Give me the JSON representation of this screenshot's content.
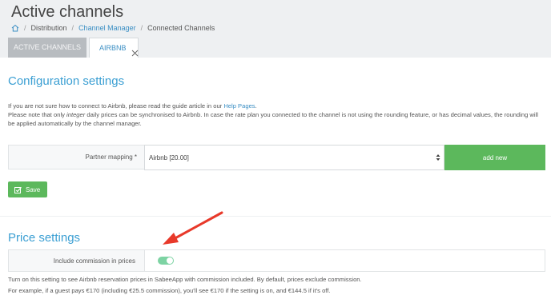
{
  "header": {
    "title": "Active channels",
    "breadcrumb": {
      "items": [
        "Distribution",
        "Channel Manager",
        "Connected Channels"
      ],
      "separator": "/"
    }
  },
  "tabs": [
    {
      "label": "ACTIVE CHANNELS",
      "active": false
    },
    {
      "label": "AIRBNB",
      "active": true
    }
  ],
  "configuration": {
    "title": "Configuration settings",
    "intro_text": "If you are not sure how to connect to Airbnb, please read the guide article in our ",
    "intro_link": "Help Pages",
    "intro_end": ".",
    "note_prefix": "Please note that only ",
    "note_emphasis": "integer",
    "note_suffix": " daily prices can be synchronised to Airbnb. In case the rate plan you connected to the channel is not using the rounding feature, or has decimal values, the rounding will be applied automatically by the channel manager.",
    "partner_mapping_label": "Partner mapping *",
    "partner_mapping_value": "Airbnb [20.00]",
    "add_new_label": "add new",
    "save_label": "Save"
  },
  "price": {
    "title": "Price settings",
    "commission_label": "Include commission in prices",
    "commission_enabled": true,
    "desc1": "Turn on this setting to see Airbnb reservation prices in SabeeApp with commission included. By default, prices exclude commission.",
    "desc2": "For example, if a guest pays €170 (including €25.5 commission), you'll see €170 if the setting is on, and €144.5 if it's off."
  },
  "colors": {
    "accent": "#3b9fd3",
    "success": "#5cb85c",
    "toggle_on": "#7dd3a3",
    "annotation_arrow": "#e8392a"
  }
}
